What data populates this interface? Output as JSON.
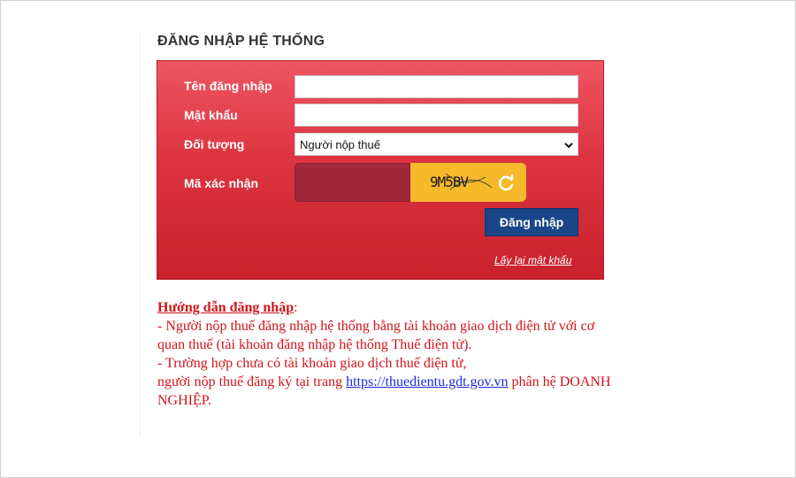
{
  "login": {
    "title": "ĐĂNG NHẬP HỆ THỐNG",
    "username_label": "Tên đăng nhập",
    "username_value": "",
    "password_label": "Mật khẩu",
    "password_value": "",
    "role_label": "Đối tượng",
    "role_selected": "Người nộp thuế",
    "captcha_label": "Mã xác nhận",
    "captcha_value": "",
    "captcha_text": "9M5BV",
    "submit_label": "Đăng nhập",
    "forgot_label": "Lấy lại mật khẩu",
    "icons": {
      "dropdown": "chevron-down-icon",
      "refresh": "refresh-icon"
    },
    "colors": {
      "panel": "#dc3440",
      "button": "#1a4688",
      "captcha_bg": "#f6b92a",
      "guide_text": "#d0141b",
      "link": "#1a2bd6"
    }
  },
  "guide": {
    "heading": "Hướng dẫn đăng nhập",
    "colon": ":",
    "line1": "- Người nộp thuế đăng nhập hệ thống bằng tài khoản giao dịch điện tử với cơ quan thuế (tài khoản đăng nhập hệ thống Thuế điện tử).",
    "line2": "- Trường hợp chưa có tài khoản giao dịch thuế điện tử,",
    "line3_pre": "người nộp thuế đăng ký tại trang ",
    "link": "https://thuedientu.gdt.gov.vn",
    "line3_post": " phân hệ DOANH NGHIỆP."
  }
}
